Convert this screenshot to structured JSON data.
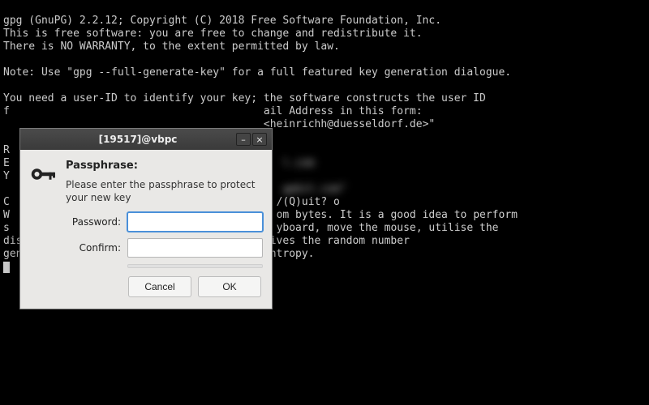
{
  "terminal": {
    "l1": "gpg (GnuPG) 2.2.12; Copyright (C) 2018 Free Software Foundation, Inc.",
    "l2": "This is free software: you are free to change and redistribute it.",
    "l3": "There is NO WARRANTY, to the extent permitted by law.",
    "l4": "",
    "l5": "Note: Use \"gpg --full-generate-key\" for a full featured key generation dialogue.",
    "l6": "",
    "l7": "You need a user-ID to identify your key; the software constructs the user ID",
    "l8a": "f",
    "l8b": "ail Address in this form:",
    "l9": "<heinrichh@duesseldorf.de>\"",
    "l10": "",
    "l11": "R",
    "l12a": "E",
    "l12b": "l.com",
    "l13a": "Y",
    "l14": "",
    "l13b": "gpbit.com\"",
    "l15a": "C",
    "l15b": "/(Q)uit? o",
    "l16a": "W",
    "l16b": "om bytes. It is a good idea to perform",
    "l17a": "s",
    "l17b": "yboard, move the mouse, utilise the",
    "l18": "disks) during the prime generation; this gives the random number",
    "l19": "generator a better chance to gain enough entropy."
  },
  "dialog": {
    "title": "[19517]@vbpc",
    "heading": "Passphrase:",
    "message": "Please enter the passphrase to protect your new key",
    "password_label": "Password:",
    "confirm_label": "Confirm:",
    "password_value": "",
    "confirm_value": "",
    "cancel": "Cancel",
    "ok": "OK"
  }
}
